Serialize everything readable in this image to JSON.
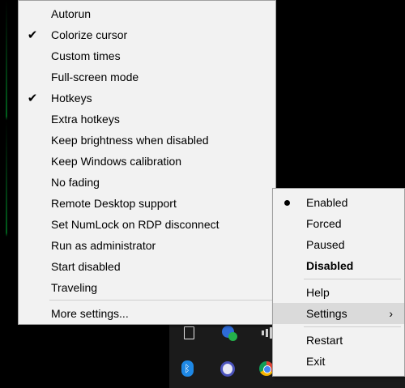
{
  "main_menu": {
    "items": [
      {
        "label": "Autorun",
        "checked": false
      },
      {
        "label": "Colorize cursor",
        "checked": true
      },
      {
        "label": "Custom times",
        "checked": false
      },
      {
        "label": "Full-screen mode",
        "checked": false
      },
      {
        "label": "Hotkeys",
        "checked": true
      },
      {
        "label": "Extra hotkeys",
        "checked": false
      },
      {
        "label": "Keep brightness when disabled",
        "checked": false
      },
      {
        "label": "Keep Windows calibration",
        "checked": false
      },
      {
        "label": "No fading",
        "checked": false
      },
      {
        "label": "Remote Desktop support",
        "checked": false
      },
      {
        "label": "Set NumLock on RDP disconnect",
        "checked": false
      },
      {
        "label": "Run as administrator",
        "checked": false
      },
      {
        "label": "Start disabled",
        "checked": false
      },
      {
        "label": "Traveling",
        "checked": false
      }
    ],
    "more_settings": "More settings..."
  },
  "context_menu": {
    "modes": [
      {
        "label": "Enabled",
        "selected": true
      },
      {
        "label": "Forced",
        "selected": false
      },
      {
        "label": "Paused",
        "selected": false
      },
      {
        "label": "Disabled",
        "selected": false,
        "bold": true
      }
    ],
    "help": "Help",
    "settings": "Settings",
    "settings_arrow": "›",
    "restart": "Restart",
    "exit": "Exit"
  },
  "glyphs": {
    "check": "✔",
    "bluetooth": "ᛒ"
  },
  "icons": [
    "file-icon",
    "shield-check-icon",
    "signal-bars-icon",
    "bluetooth-icon",
    "teams-icon",
    "chrome-icon"
  ],
  "colors": {
    "menu_bg": "#f2f2f2",
    "highlight": "#dadada",
    "desktop": "#000000"
  }
}
